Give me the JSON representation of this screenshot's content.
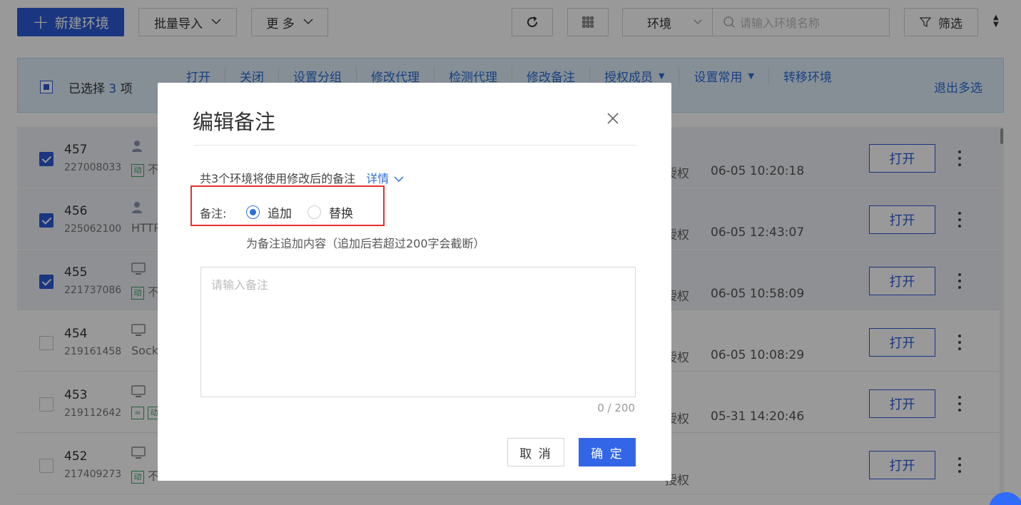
{
  "toolbar": {
    "new_env": "新建环境",
    "batch_import": "批量导入",
    "more": "更 多",
    "env_select": "环境",
    "search_placeholder": "请输入环境名称",
    "filter": "筛选"
  },
  "selection_bar": {
    "prefix": "已选择",
    "count": "3",
    "suffix": "项",
    "actions": [
      "打开",
      "关闭",
      "设置分组",
      "修改代理",
      "检测代理",
      "修改备注",
      "授权成员",
      "设置常用",
      "转移环境"
    ],
    "exit": "退出多选"
  },
  "rows": [
    {
      "num": "457",
      "sub": "227008033",
      "frag_tag": "动",
      "frag": "不",
      "auth": "授权",
      "time": "06-05 10:20:18",
      "open": "打开"
    },
    {
      "num": "456",
      "sub": "225062100",
      "frag_tag": "",
      "frag": "HTTP",
      "auth": "授权",
      "time": "06-05 12:43:07",
      "open": "打开"
    },
    {
      "num": "455",
      "sub": "221737086",
      "frag_tag": "动",
      "frag": "不",
      "auth": "授权",
      "time": "06-05 10:58:09",
      "open": "打开"
    },
    {
      "num": "454",
      "sub": "219161458",
      "frag_tag": "",
      "frag": "Sock",
      "auth": "授权",
      "time": "06-05 10:08:29",
      "open": "打开"
    },
    {
      "num": "453",
      "sub": "219112642",
      "frag_tag": "动",
      "frag": "",
      "auth": "授权",
      "time": "05-31 14:20:46",
      "open": "打开"
    },
    {
      "num": "452",
      "sub": "217409273",
      "frag_tag": "动",
      "frag": "不",
      "auth": "授权",
      "time": "",
      "open": "打开"
    }
  ],
  "modal": {
    "title": "编辑备注",
    "info": "共3个环境将使用修改后的备注",
    "detail": "详情",
    "remark_label": "备注:",
    "radio_append": "追加",
    "radio_replace": "替换",
    "hint": "为备注追加内容（追加后若超过200字会截断）",
    "textarea_placeholder": "请输入备注",
    "counter": "0 / 200",
    "cancel": "取 消",
    "confirm": "确 定"
  },
  "colors": {
    "primary": "#2c5bd6",
    "link": "#2c6fd6",
    "highlight": "#e53030"
  }
}
